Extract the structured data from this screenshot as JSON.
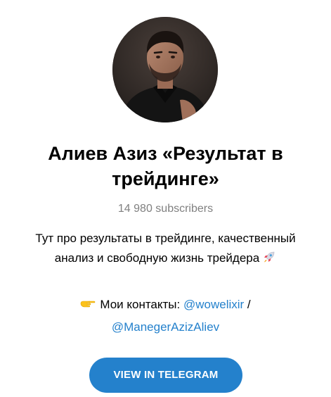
{
  "channel": {
    "title_line1": "Алиев Азиз «Результат в",
    "title_line2": "трейдинге»",
    "subscribers": "14 980 subscribers",
    "description_line1": "Тут про результаты в трейдинге, качественный",
    "description_line2": "анализ и свободную жизнь трейдера",
    "description_emoji": "rocket-icon"
  },
  "contacts": {
    "emoji": "pointing-hand-icon",
    "label": "Мои контакты: ",
    "link1": "@wowelixir",
    "separator": " /",
    "link2": "@ManegerAzizAliev"
  },
  "button": {
    "label": "VIEW IN TELEGRAM"
  },
  "colors": {
    "accent": "#2481cc",
    "muted": "#808080",
    "text": "#000000",
    "background": "#ffffff"
  }
}
